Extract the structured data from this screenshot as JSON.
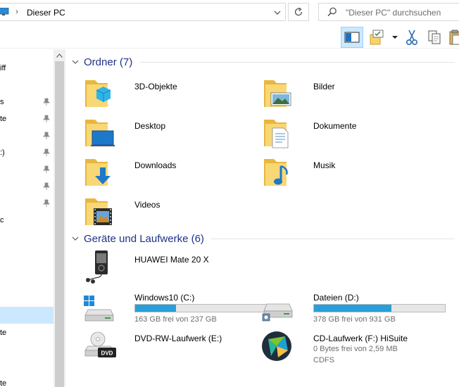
{
  "address": {
    "path_label": "Dieser PC",
    "separator": "›",
    "search_placeholder": "\"Dieser PC\" durchsuchen"
  },
  "nav": {
    "items": [
      {
        "label": "iff",
        "pinned": false
      },
      {
        "label": "s",
        "pinned": true
      },
      {
        "label": "te",
        "pinned": true
      },
      {
        "label": "",
        "pinned": true
      },
      {
        "label": ":)",
        "pinned": true
      },
      {
        "label": "",
        "pinned": true
      },
      {
        "label": "",
        "pinned": true
      },
      {
        "label": "",
        "pinned": true
      },
      {
        "label": "c",
        "pinned": false
      },
      {
        "label": "",
        "pinned": false
      },
      {
        "label": "",
        "pinned": false
      },
      {
        "label": "",
        "pinned": false
      },
      {
        "label": "",
        "selected": true
      },
      {
        "label": "te",
        "pinned": false
      },
      {
        "label": "",
        "pinned": false
      },
      {
        "label": "",
        "pinned": false
      },
      {
        "label": "",
        "pinned": false
      },
      {
        "label": "",
        "pinned": false
      },
      {
        "label": "te",
        "pinned": false
      }
    ]
  },
  "groups": {
    "folders": {
      "title": "Ordner (7)",
      "items": [
        {
          "label": "3D-Objekte",
          "icon": "3d-objects-folder-icon"
        },
        {
          "label": "Bilder",
          "icon": "pictures-folder-icon"
        },
        {
          "label": "Desktop",
          "icon": "desktop-folder-icon"
        },
        {
          "label": "Dokumente",
          "icon": "documents-folder-icon"
        },
        {
          "label": "Downloads",
          "icon": "downloads-folder-icon"
        },
        {
          "label": "Musik",
          "icon": "music-folder-icon"
        },
        {
          "label": "Videos",
          "icon": "videos-folder-icon"
        }
      ]
    },
    "devices": {
      "title": "Geräte und Laufwerke (6)",
      "phone": {
        "label": "HUAWEI Mate 20 X",
        "icon": "media-player-icon"
      },
      "drives": [
        {
          "label": "Windows10 (C:)",
          "free": "163 GB frei von 237 GB",
          "used_fraction": 0.31,
          "icon": "windows-drive-icon"
        },
        {
          "label": "Dateien (D:)",
          "free": "378 GB frei von 931 GB",
          "used_fraction": 0.59,
          "icon": "drive-icon"
        },
        {
          "label": "DVD-RW-Laufwerk (E:)",
          "icon": "dvd-drive-icon"
        },
        {
          "label": "CD-Laufwerk (F:) HiSuite",
          "free": "0 Bytes frei von 2,59 MB",
          "filesystem": "CDFS",
          "icon": "hisuite-icon"
        }
      ]
    }
  },
  "colors": {
    "accent": "#26a0da",
    "group_title": "#1e3287",
    "selection": "#cce8ff",
    "folder": "#f8d775"
  }
}
